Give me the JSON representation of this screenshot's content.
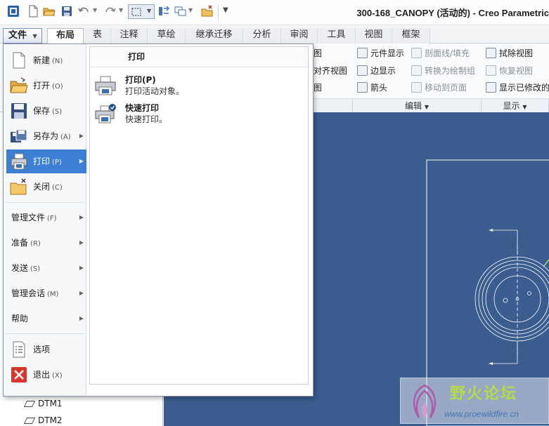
{
  "app": {
    "title": "300-168_CANOPY (活动的) - Creo Parametric"
  },
  "quick_access": {
    "icons": [
      "app-menu-icon",
      "new-icon",
      "open-icon",
      "save-icon",
      "undo-icon",
      "redo-icon",
      "select-box-icon",
      "regenerate-icon",
      "windows-icon",
      "close-window-icon",
      "customize-icon"
    ]
  },
  "ribbon_tabs": [
    {
      "label": "文件",
      "active": false
    },
    {
      "label": "布局",
      "active": true
    },
    {
      "label": "表",
      "active": false
    },
    {
      "label": "注释",
      "active": false
    },
    {
      "label": "草绘",
      "active": false
    },
    {
      "label": "继承迁移",
      "active": false
    },
    {
      "label": "分析",
      "active": false
    },
    {
      "label": "审阅",
      "active": false
    },
    {
      "label": "工具",
      "active": false
    },
    {
      "label": "视图",
      "active": false
    },
    {
      "label": "框架",
      "active": false
    }
  ],
  "ribbon": {
    "partial_left": {
      "row1": "图",
      "row2": "对齐视图",
      "row3": "图"
    },
    "edit": {
      "element_display": "元件显示",
      "edge_display": "边显示",
      "arrow": "箭头",
      "section_hatch": "剖面线/填充",
      "convert_to_draw_group": "转换为绘制组",
      "move_to_page": "移动到页面",
      "group_label": "编辑"
    },
    "display": {
      "erase_view": "拭除视图",
      "restore_view": "恢复视图",
      "show_modified": "显示已修改的",
      "group_label": "显示"
    }
  },
  "file_menu": {
    "items": [
      {
        "label": "新建",
        "shortcut": "(N)",
        "icon": "new-file-icon"
      },
      {
        "label": "打开",
        "shortcut": "(O)",
        "icon": "open-folder-icon"
      },
      {
        "label": "保存",
        "shortcut": "(S)",
        "icon": "save-icon"
      },
      {
        "label": "另存为",
        "shortcut": "(A)",
        "icon": "save-as-icon"
      },
      {
        "label": "打印",
        "shortcut": "(P)",
        "icon": "print-icon"
      },
      {
        "label": "关闭",
        "shortcut": "(C)",
        "icon": "close-folder-icon"
      },
      {
        "label": "管理文件",
        "shortcut": "(F)"
      },
      {
        "label": "准备",
        "shortcut": "(R)"
      },
      {
        "label": "发送",
        "shortcut": "(S)"
      },
      {
        "label": "管理会话",
        "shortcut": "(M)"
      },
      {
        "label": "帮助",
        "shortcut": ""
      },
      {
        "label": "选项",
        "shortcut": "",
        "icon": "options-icon"
      },
      {
        "label": "退出",
        "shortcut": "(X)",
        "icon": "exit-icon"
      }
    ],
    "selected": "打印"
  },
  "print_submenu": {
    "heading": "打印",
    "items": [
      {
        "title": "打印(P)",
        "desc": "打印活动对象。",
        "icon": "printer-icon"
      },
      {
        "title": "快速打印",
        "desc": "快速打印。",
        "icon": "quick-print-icon"
      }
    ]
  },
  "model_tree": {
    "nodes": [
      "DTM1",
      "DTM2"
    ]
  },
  "watermark": {
    "name": "野火论坛",
    "url": "www.proewildfire.cn"
  }
}
